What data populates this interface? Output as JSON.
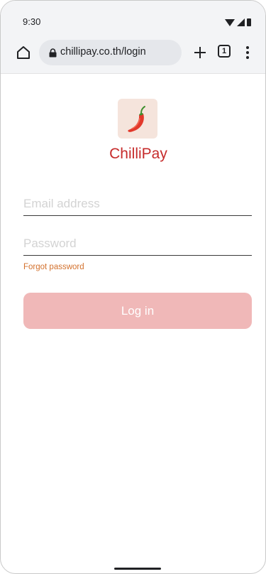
{
  "status_bar": {
    "time": "9:30"
  },
  "browser": {
    "url": "chillipay.co.th/login",
    "tab_count": "1"
  },
  "brand": {
    "name": "ChilliPay",
    "color": "#c62b2b"
  },
  "login_form": {
    "email_placeholder": "Email address",
    "password_placeholder": "Password",
    "forgot_password": "Forgot password",
    "login_label": "Log in",
    "button_color": "#f0b8b8",
    "link_color": "#d3712d"
  },
  "icons": {
    "home": "home-icon",
    "lock": "lock-icon",
    "new_tab": "plus-icon",
    "tabs": "tab-switcher-icon",
    "menu": "more-vert-icon",
    "logo": "chili-pepper-icon"
  }
}
